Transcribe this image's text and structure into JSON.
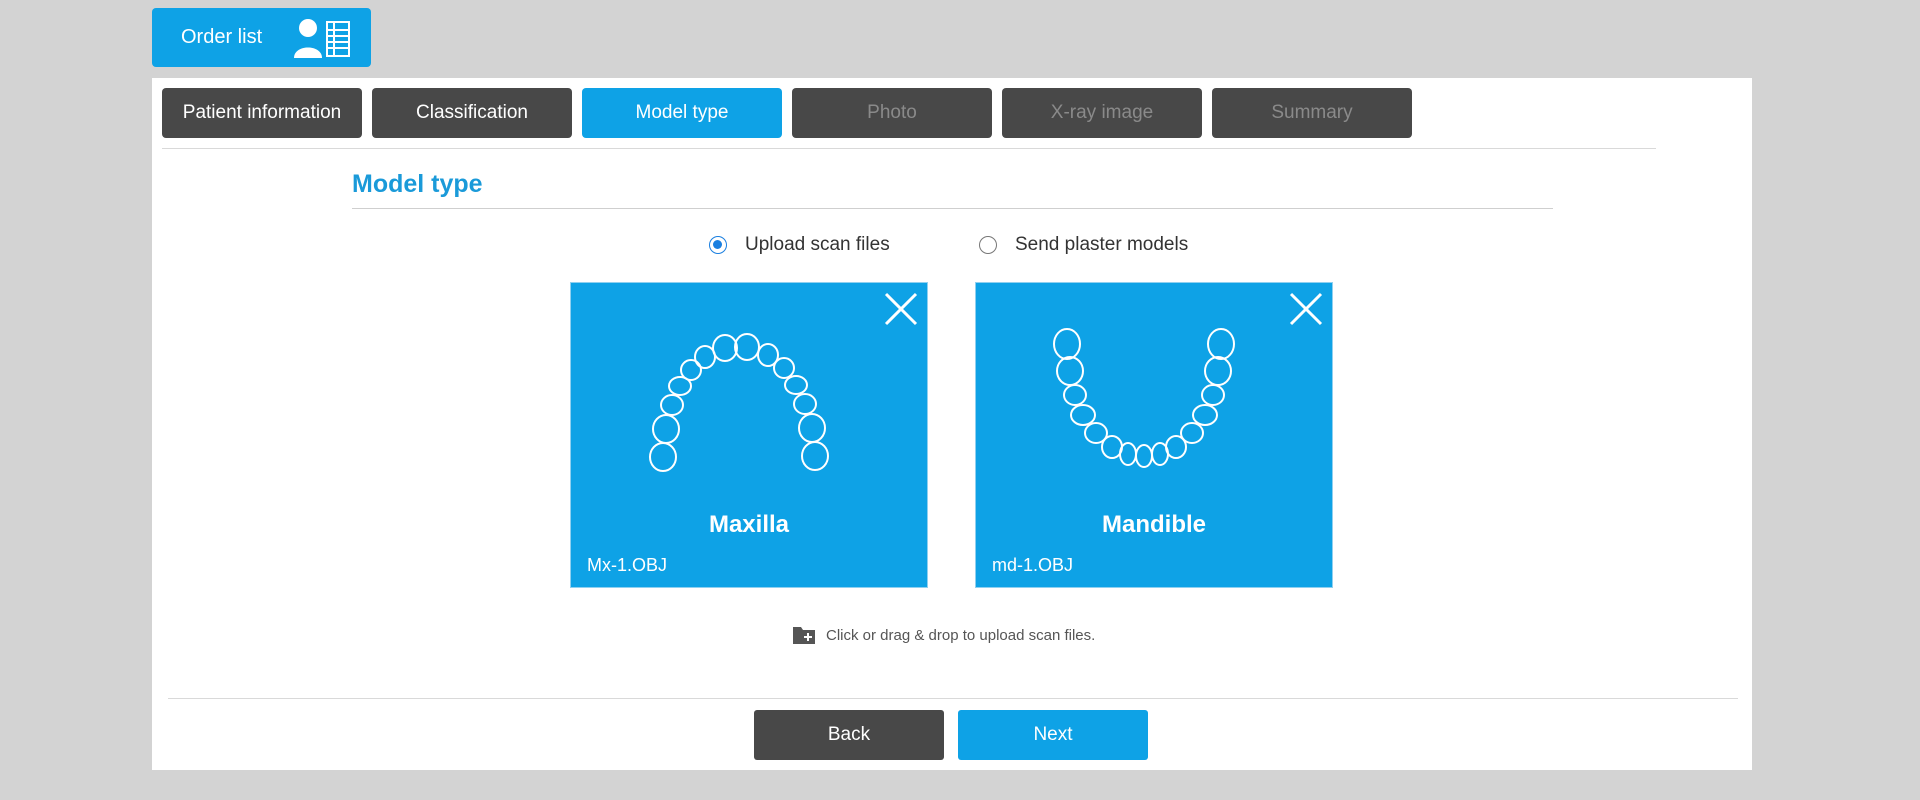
{
  "header": {
    "order_list_label": "Order list",
    "order_list_icon": "user-list-icon"
  },
  "tabs": [
    {
      "label": "Patient information",
      "state": "done"
    },
    {
      "label": "Classification",
      "state": "done"
    },
    {
      "label": "Model type",
      "state": "active"
    },
    {
      "label": "Photo",
      "state": "disabled"
    },
    {
      "label": "X-ray image",
      "state": "disabled"
    },
    {
      "label": "Summary",
      "state": "disabled"
    }
  ],
  "section": {
    "title": "Model type"
  },
  "options": [
    {
      "label": "Upload scan files",
      "checked": true
    },
    {
      "label": "Send plaster models",
      "checked": false
    }
  ],
  "cards": [
    {
      "title": "Maxilla",
      "file": "Mx-1.OBJ",
      "icon": "maxilla-teeth-icon"
    },
    {
      "title": "Mandible",
      "file": "md-1.OBJ",
      "icon": "mandible-teeth-icon"
    }
  ],
  "upload_hint": {
    "text": "Click or drag & drop to upload scan files.",
    "icon": "folder-add-icon"
  },
  "footer": {
    "back_label": "Back",
    "next_label": "Next"
  },
  "colors": {
    "accent": "#0ea2e6",
    "dark_tab": "#484848",
    "title": "#1a9ad9",
    "background": "#d3d3d3"
  }
}
